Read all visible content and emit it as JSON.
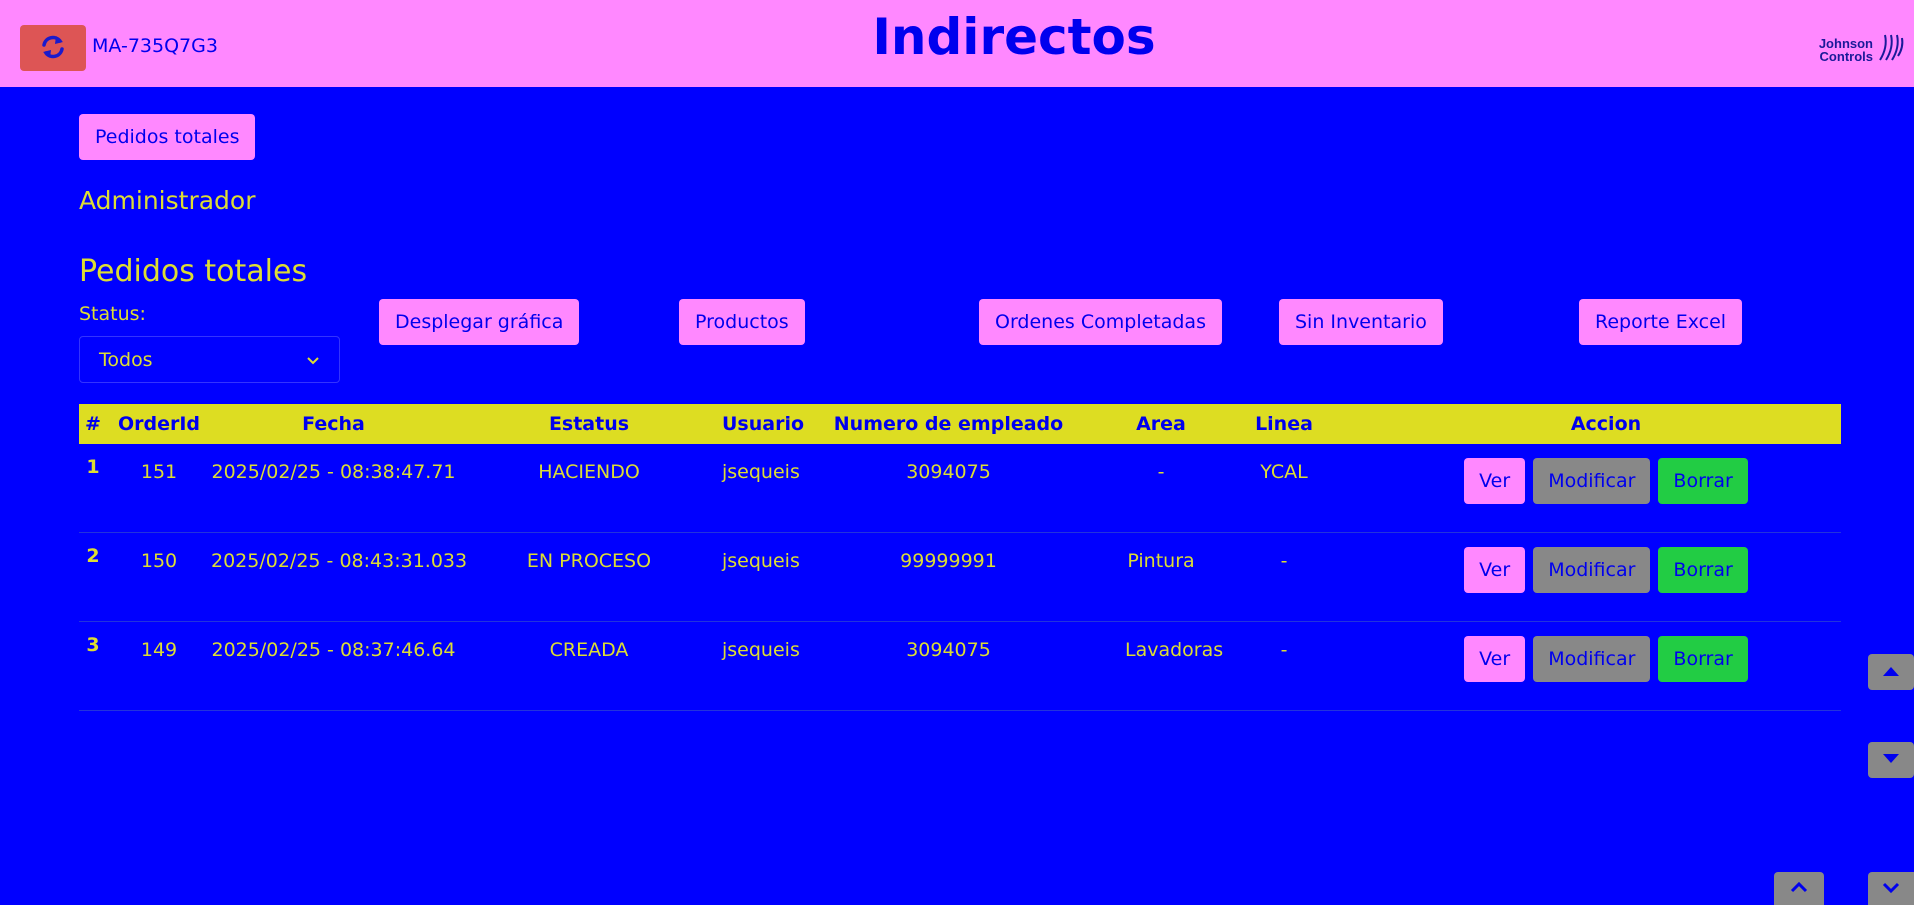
{
  "header": {
    "title": "Indirectos",
    "device_id": "MA-735Q7G3",
    "logo_line1": "Johnson",
    "logo_line2": "Controls",
    "refresh_icon": "refresh-icon"
  },
  "nav": {
    "pedidos_totales_button": "Pedidos totales"
  },
  "role": "Administrador",
  "section_title": "Pedidos totales",
  "filter": {
    "status_label": "Status:",
    "status_value": "Todos"
  },
  "toolbar": {
    "grafica": "Desplegar gráfica",
    "productos": "Productos",
    "completadas": "Ordenes Completadas",
    "sin_inventario": "Sin Inventario",
    "reporte_excel": "Reporte Excel"
  },
  "table": {
    "headers": [
      "#",
      "OrderId",
      "Fecha",
      "Estatus",
      "Usuario",
      "Numero de empleado",
      "Area",
      "Linea",
      "Accion"
    ],
    "rows": [
      {
        "idx": "1",
        "order_id": "151",
        "fecha": "2025/02/25 - 08:38:47.71",
        "estatus": "HACIENDO",
        "usuario": "jsequeis",
        "empleado": "3094075",
        "area": "-",
        "linea": "YCAL"
      },
      {
        "idx": "2",
        "order_id": "150",
        "fecha": "2025/02/25 - 08:43:31.033",
        "estatus": "EN PROCESO",
        "usuario": "jsequeis",
        "empleado": "99999991",
        "area": "Pintura",
        "linea": "-"
      },
      {
        "idx": "3",
        "order_id": "149",
        "fecha": "2025/02/25 - 08:37:46.64",
        "estatus": "CREADA",
        "usuario": "jsequeis",
        "empleado": "3094075",
        "area": "Lavadoras",
        "linea": "-"
      }
    ],
    "actions": {
      "ver": "Ver",
      "modificar": "Modificar",
      "borrar": "Borrar"
    }
  },
  "colors": {
    "background": "#0000ff",
    "topbar": "#ff88ff",
    "accent_text": "#dddd33",
    "header_row": "#dddd22",
    "delete": "#22cc44",
    "modify": "#888888",
    "refresh": "#dd5555"
  }
}
